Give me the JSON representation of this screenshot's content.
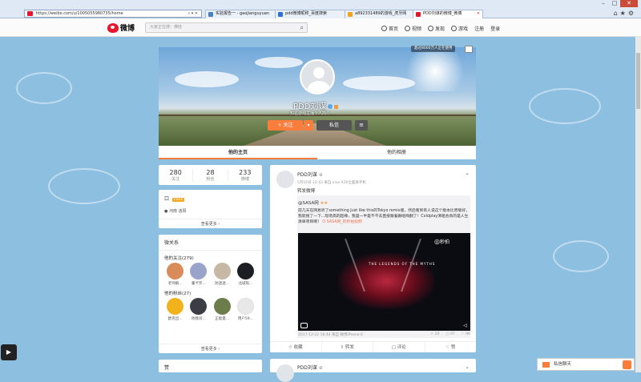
{
  "browser": {
    "url": "https://weibo.com/u/1005055980735/home",
    "tabs": [
      {
        "label": "实验报告一 - gaojianguyuan"
      },
      {
        "label": "pdd微博昵称_百度搜索"
      },
      {
        "label": "a892331489的游戏_虎牙网"
      },
      {
        "label": "PDD刘谋的微博_微博"
      }
    ],
    "colors": {
      "tab_icon_1": "#4a7fc1",
      "tab_icon_2": "#2f6fdc",
      "tab_icon_3": "#f2a122",
      "tab_icon_4": "#e6162d"
    }
  },
  "nav": {
    "logo_text": "微博",
    "search_placeholder": "大家正在搜：佛娃",
    "links": [
      "首页",
      "视频",
      "发现",
      "游戏",
      "注册",
      "登录"
    ]
  },
  "profile": {
    "online_badge": "超过8000万人正在使用",
    "name": "PDD刘谋",
    "desc": "知名游戏主播个人简介",
    "follow_label": "+ 关注",
    "message_label": "私信",
    "tabs": [
      "他的主页",
      "他的相册"
    ]
  },
  "stats": [
    {
      "value": "280",
      "label": "关注"
    },
    {
      "value": "28",
      "label": "粉丝"
    },
    {
      "value": "233",
      "label": "微博"
    }
  ],
  "info": {
    "level_prefix": "Lv",
    "level": "Lv14",
    "location": "河南 洛阳",
    "more_label": "查看更多 ›"
  },
  "relations": {
    "title": "微关系",
    "following_title": "他的关注(279)",
    "following": [
      "老师解...",
      "董卡罗...",
      "防迷迷...",
      "北城照..."
    ],
    "fans_title": "他的粉丝(27)",
    "fans": [
      "欧克出...",
      "他我肖...",
      "正能量...",
      "用户59..."
    ],
    "more_label": "查看更多 ›",
    "avatar_colors": [
      "#d98b5a",
      "#9aa3c9",
      "#c7b8a5",
      "#1d1d24",
      "#f2b21b",
      "#3c3d44",
      "#6a7d4a",
      "#e8e8e8"
    ]
  },
  "bottom_card_title": "赞",
  "feed": {
    "user": "PDD刘谋",
    "meta": "5月10日 22:43 来自 vivo X20全面屏手机",
    "text": "转发微博",
    "rt_user": "@SASA网",
    "rt_text": "前几天在网易听了something Just like this的Tokyo remix版，然后看到有人说这个版本比原版好，我就搜了一下...现场高的超棒，我是一半是不不去直接跟着跟唱嗨翻了！Coldplay演唱会真的是人生清单项目啊！",
    "rt_link": "O SASA网_的秒拍视频",
    "video_title": "THE LEGENDS OF THE MYTHS",
    "video_brand": "秒拍",
    "rt_time": "2017-12-22 16:44 来自 微博iPhone 6",
    "rt_shares": "20",
    "rt_comments": "97",
    "rt_likes": "96",
    "actions": [
      "收藏",
      "转发",
      "评论",
      "赞"
    ]
  },
  "feed2_user": "PDD刘谋",
  "chat": {
    "label": "私信聊天"
  }
}
